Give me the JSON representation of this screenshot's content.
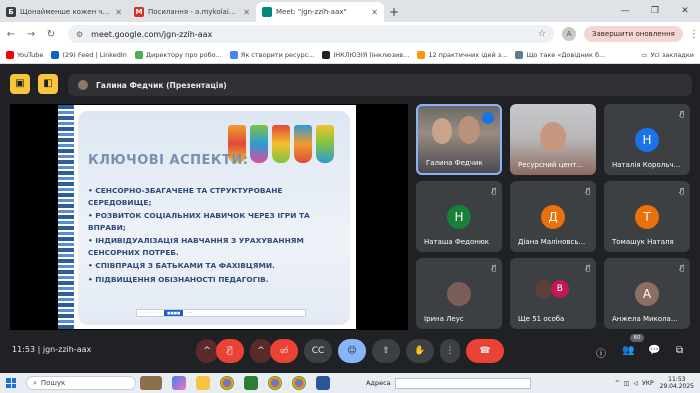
{
  "browser": {
    "tabs": [
      {
        "title": "Щонайменше кожен четвертий ...",
        "favicon_letter": "Б",
        "favicon_color": "#3d3d3d",
        "active": false
      },
      {
        "title": "Посилання - a.mykolaichuk@vipp...",
        "favicon_letter": "M",
        "favicon_color": "#d93025",
        "active": false
      },
      {
        "title": "Meet: \"jgn-zzih-aax\"",
        "favicon_letter": "",
        "favicon_color": "#00897b",
        "active": true
      }
    ],
    "new_tab": "+",
    "url": "meet.google.com/jgn-zzih-aax",
    "profile_letter": "A",
    "update_button": "Завершити оновлення",
    "bookmarks": [
      {
        "label": "YouTube",
        "color": "#ff0000"
      },
      {
        "label": "(29) Feed | LinkedIn",
        "color": "#0a66c2"
      },
      {
        "label": "Директору про робо...",
        "color": "#4caf50"
      },
      {
        "label": "Як створити ресурс...",
        "color": "#4285f4"
      },
      {
        "label": "ІНКЛЮЗІЯ (Інклюзив...",
        "color": "#222222"
      },
      {
        "label": "12 практичних ідей з...",
        "color": "#ff9800"
      },
      {
        "label": "Що таке «Довідник б...",
        "color": "#607d8b"
      }
    ],
    "all_bookmarks": "Усі закладки"
  },
  "meet": {
    "presenter_label": "Галина Федчик (Презентація)",
    "slide": {
      "heading": "КЛЮЧОВІ АСПЕКТИ:",
      "bullets": [
        "•   СЕНСОРНО-ЗБАГАЧЕНЕ ТА СТРУКТУРОВАНЕ СЕРЕДОВИЩЕ;",
        "•  РОЗВИТОК СОЦІАЛЬНИХ НАВИЧОК ЧЕРЕЗ ІГРИ ТА ВПРАВИ;",
        "•  ІНДИВІДУАЛІЗАЦІЯ НАВЧАННЯ З УРАХУВАННЯМ СЕНСОРНИХ ПОТРЕБ.",
        "•  СПІВПРАЦЯ З БАТЬКАМИ ТА ФАХІВЦЯМИ.",
        "•  ПІДВИЩЕННЯ ОБІЗНАНОСТІ ПЕДАГОГІВ."
      ]
    },
    "participants": [
      {
        "name": "Галина Федчик",
        "avatar": "",
        "color": ""
      },
      {
        "name": "Ресурсний цент...",
        "avatar": "",
        "color": ""
      },
      {
        "name": "Наталія Корольч...",
        "avatar": "Н",
        "color": "#1a73e8"
      },
      {
        "name": "Наташа Федонюк",
        "avatar": "Н",
        "color": "#188038"
      },
      {
        "name": "Діана Маліновсь...",
        "avatar": "Д",
        "color": "#e8710a"
      },
      {
        "name": "Томашук Наталя",
        "avatar": "Т",
        "color": "#e8710a"
      },
      {
        "name": "Ірина Леус",
        "avatar": "",
        "color": "#7b5e57"
      },
      {
        "name": "Ще 51 особа",
        "avatar": "В",
        "color": "#c2185b"
      },
      {
        "name": "Анжела Микола...",
        "avatar": "А",
        "color": "#8d6e63"
      }
    ],
    "time": "11:53",
    "meeting_code": "jgn-zzih-aax",
    "participant_count": "60"
  },
  "taskbar": {
    "search_placeholder": "Пошук",
    "address_label": "Адреса",
    "language": "УКР",
    "clock_time": "11:53",
    "clock_date": "29.04.2025"
  }
}
